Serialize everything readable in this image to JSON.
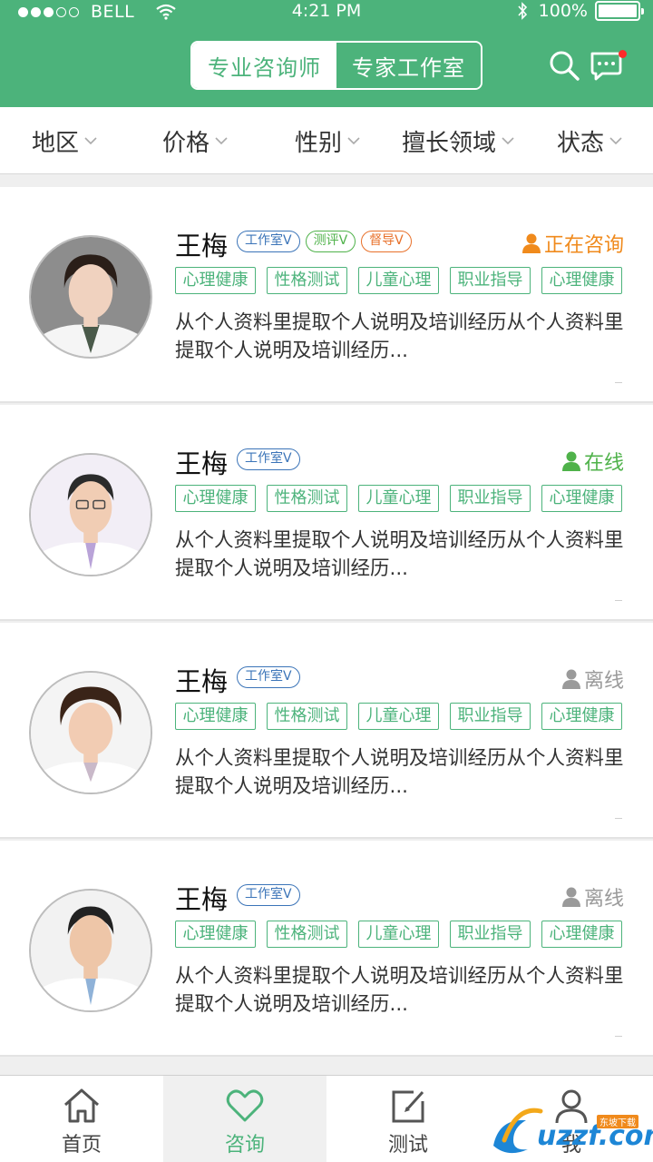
{
  "status_bar": {
    "carrier": "BELL",
    "time": "4:21 PM",
    "battery": "100%"
  },
  "header": {
    "segments": [
      {
        "label": "专业咨询师",
        "active": false
      },
      {
        "label": "专家工作室",
        "active": true
      }
    ],
    "icons": [
      "search-icon",
      "message-icon"
    ],
    "accent": "#4cb37b"
  },
  "filters": [
    "地区",
    "价格",
    "性别",
    "擅长领域",
    "状态"
  ],
  "counselors": [
    {
      "name": "王梅",
      "badges": [
        {
          "label": "工作室V",
          "color": "#3b74b8"
        },
        {
          "label": "测评V",
          "color": "#4fb24a"
        },
        {
          "label": "督导V",
          "color": "#e8702a"
        }
      ],
      "status": "正在咨询",
      "status_color": "#f08a1c",
      "tags": [
        "心理健康",
        "性格测试",
        "儿童心理",
        "职业指导",
        "心理健康"
      ],
      "description": "从个人资料里提取个人说明及培训经历从个人资料里提取个人说明及培训经历..."
    },
    {
      "name": "王梅",
      "badges": [
        {
          "label": "工作室V",
          "color": "#3b74b8"
        }
      ],
      "status": "在线",
      "status_color": "#4fb24a",
      "tags": [
        "心理健康",
        "性格测试",
        "儿童心理",
        "职业指导",
        "心理健康"
      ],
      "description": "从个人资料里提取个人说明及培训经历从个人资料里提取个人说明及培训经历..."
    },
    {
      "name": "王梅",
      "badges": [
        {
          "label": "工作室V",
          "color": "#3b74b8"
        }
      ],
      "status": "离线",
      "status_color": "#9a9a9a",
      "tags": [
        "心理健康",
        "性格测试",
        "儿童心理",
        "职业指导",
        "心理健康"
      ],
      "description": "从个人资料里提取个人说明及培训经历从个人资料里提取个人说明及培训经历..."
    },
    {
      "name": "王梅",
      "badges": [
        {
          "label": "工作室V",
          "color": "#3b74b8"
        }
      ],
      "status": "离线",
      "status_color": "#9a9a9a",
      "tags": [
        "心理健康",
        "性格测试",
        "儿童心理",
        "职业指导",
        "心理健康"
      ],
      "description": "从个人资料里提取个人说明及培训经历从个人资料里提取个人说明及培训经历..."
    }
  ],
  "tabbar": [
    {
      "label": "首页",
      "icon": "home-icon",
      "active": false
    },
    {
      "label": "咨询",
      "icon": "heart-icon",
      "active": true
    },
    {
      "label": "测试",
      "icon": "edit-icon",
      "active": false
    },
    {
      "label": "我",
      "icon": "user-icon",
      "active": false
    }
  ],
  "watermark": {
    "text": "uzzf.com",
    "small": "东坡下载"
  }
}
